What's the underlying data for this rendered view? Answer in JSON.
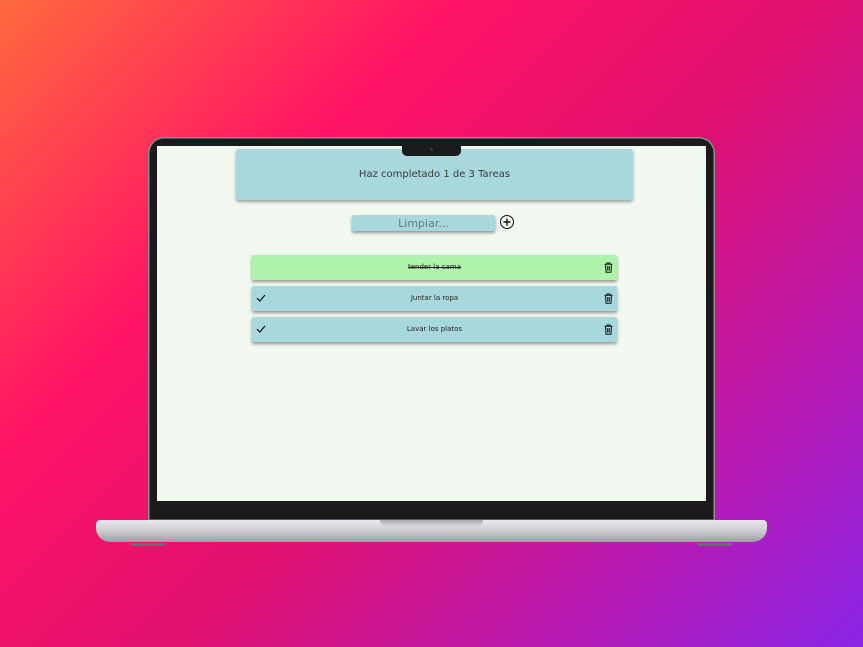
{
  "app": {
    "summary": "Haz completado 1 de 3 Tareas",
    "search": {
      "placeholder": "Limpiar...",
      "value": ""
    },
    "add_icon": "plus-circle-icon",
    "tasks": [
      {
        "text": "tender la cama",
        "completed": true
      },
      {
        "text": "Juntar la ropa",
        "completed": false
      },
      {
        "text": "Lavar los platos",
        "completed": false
      }
    ],
    "colors": {
      "card": "#a8d8dc",
      "completed_task": "#aef2ac",
      "screen_bg": "#f1f8ef"
    }
  },
  "icons": {
    "check": "check-icon",
    "delete": "trash-icon"
  }
}
